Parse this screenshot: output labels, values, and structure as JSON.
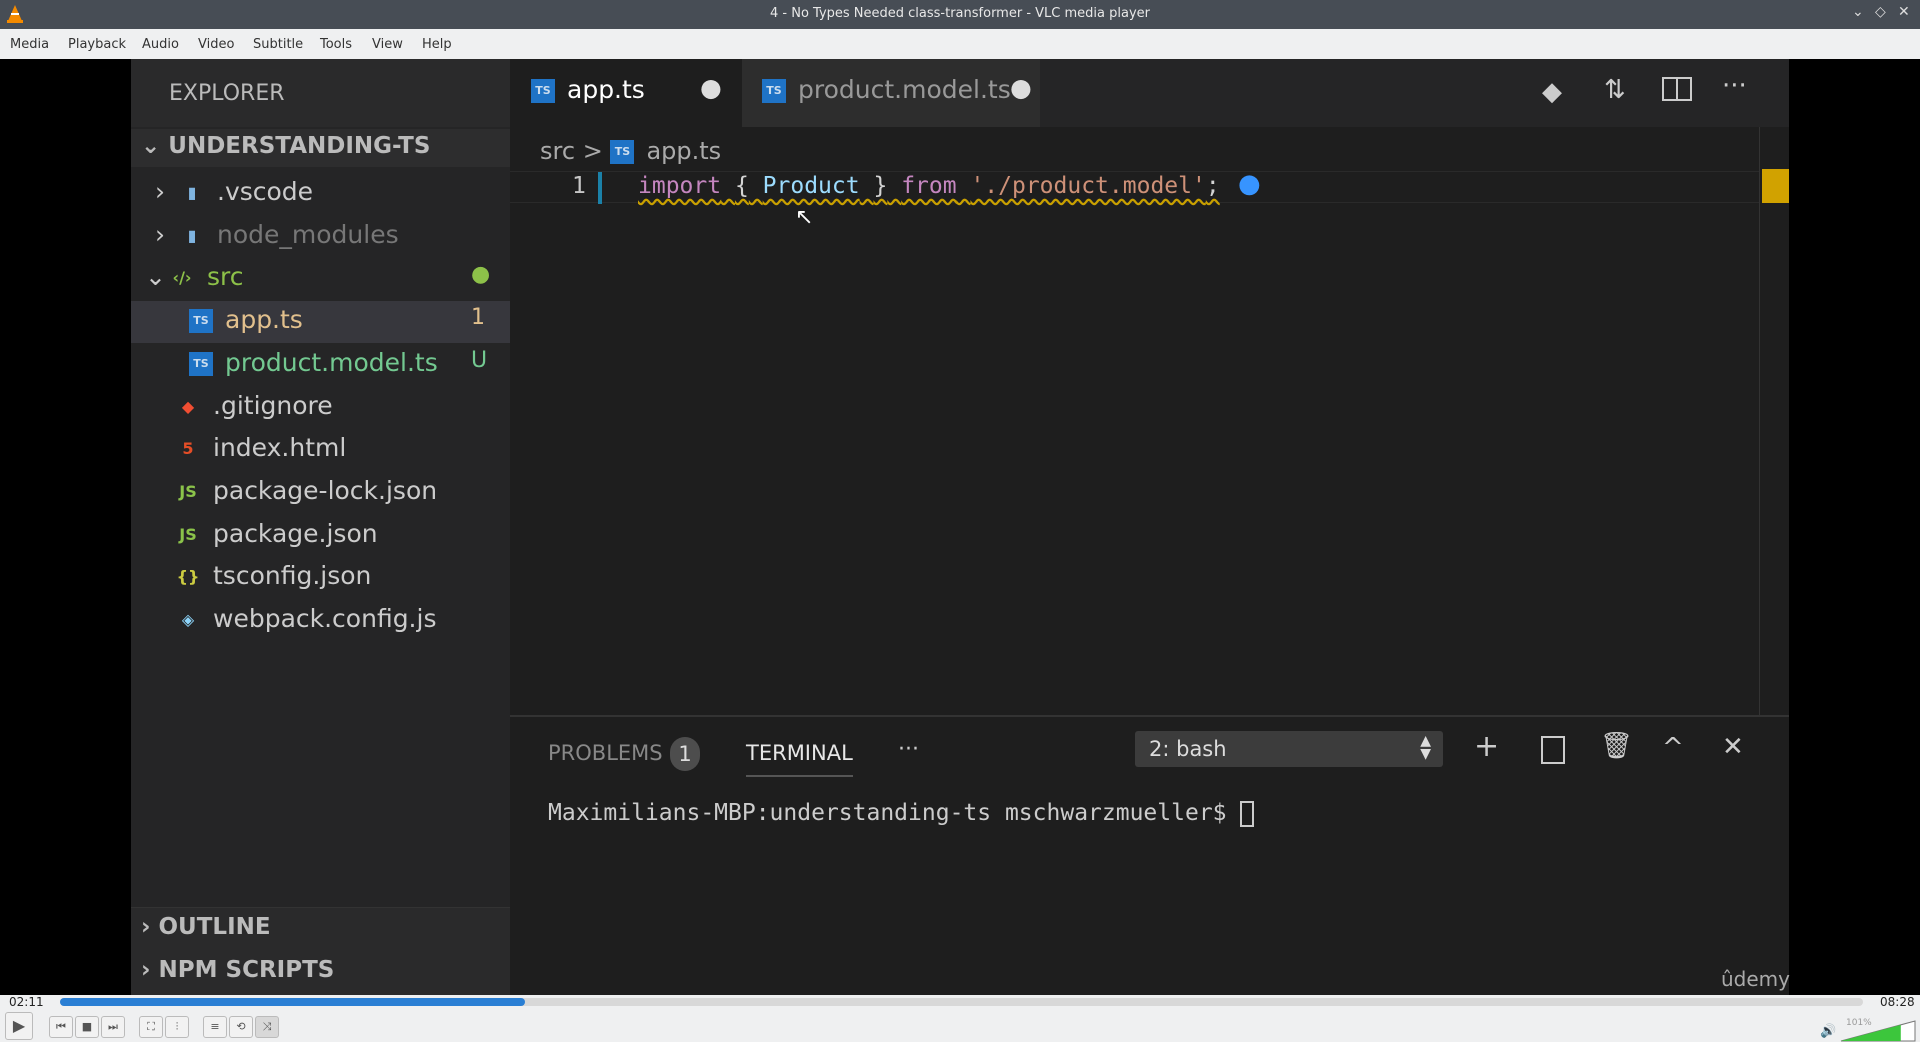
{
  "window": {
    "title": "4 - No Types Needed class-transformer - VLC media player",
    "icon": "vlc-cone-icon"
  },
  "menu": [
    "Media",
    "Playback",
    "Audio",
    "Video",
    "Subtitle",
    "Tools",
    "View",
    "Help"
  ],
  "vscode": {
    "explorer_title": "EXPLORER",
    "project": "UNDERSTANDING-TS",
    "tree": [
      {
        "name": ".vscode",
        "type": "folder",
        "color": "#ccc"
      },
      {
        "name": "node_modules",
        "type": "folder",
        "color": "#777"
      },
      {
        "name": "src",
        "type": "folder-open",
        "color": "#8dc149",
        "badge": "●"
      },
      {
        "name": "app.ts",
        "type": "ts",
        "color": "#e2c08d",
        "badge": "1"
      },
      {
        "name": "product.model.ts",
        "type": "ts",
        "color": "#73c991",
        "badge": "U"
      },
      {
        "name": ".gitignore",
        "type": "git",
        "color": "#ccc"
      },
      {
        "name": "index.html",
        "type": "html",
        "color": "#ccc"
      },
      {
        "name": "package-lock.json",
        "type": "npm",
        "color": "#ccc"
      },
      {
        "name": "package.json",
        "type": "npm",
        "color": "#ccc"
      },
      {
        "name": "tsconfig.json",
        "type": "json",
        "color": "#ccc"
      },
      {
        "name": "webpack.config.js",
        "type": "webpack",
        "color": "#ccc"
      }
    ],
    "outline": "OUTLINE",
    "npm_scripts": "NPM SCRIPTS",
    "tabs": [
      {
        "label": "app.ts",
        "active": true,
        "dirty": true
      },
      {
        "label": "product.model.ts",
        "active": false,
        "dirty": true
      }
    ],
    "breadcrumb": {
      "folder": "src",
      "sep": ">",
      "file": "app.ts"
    },
    "code": {
      "line_number": "1",
      "kw1": "import",
      "p1": "{",
      "ident": "Product",
      "p2": "}",
      "kw2": "from",
      "str": "'./product.model'",
      "semi": ";"
    },
    "panel": {
      "problems": "PROBLEMS",
      "problems_count": "1",
      "terminal": "TERMINAL",
      "more": "···",
      "shell": "2: bash",
      "prompt": "Maximilians-MBP:understanding-ts mschwarzmueller$"
    },
    "watermark": "ûdemy"
  },
  "player": {
    "elapsed": "02:11",
    "duration": "08:28",
    "progress_fraction": 0.258,
    "volume": "101%",
    "volume_fraction": 1.01
  }
}
